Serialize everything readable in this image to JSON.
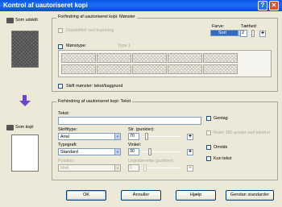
{
  "window": {
    "title": "Kontrol af uautoriseret kopi",
    "help_label": "?",
    "close_label": "✕"
  },
  "side": {
    "original_label": "Som udskilt",
    "copy_label": "Som kopi"
  },
  "pattern_section": {
    "legend": "Forfindring af uautoriseret kopi: Mønster",
    "datafield_label": "Datafeltfelt ved kopiering",
    "color_label": "Farve:",
    "color_value": "Sort",
    "density_label": "Tæthed:",
    "density_value": "2",
    "pattern_type_label": "Mønstype:",
    "type_label": "Type 1",
    "swap_label": "Skift mønster: tekst/baggrund"
  },
  "text_section": {
    "legend": "Forhindring af uautoriseret kopi: Tekst",
    "text_label": "Tekst:",
    "text_value": "",
    "font_label": "Skrifttype:",
    "font_value": "Arial",
    "size_label": "Str. (punkter):",
    "size_value": "70",
    "style_label": "Typografi:",
    "style_value": "Standard",
    "angle_label": "Vinkel:",
    "angle_value": "30",
    "position_label": "Position:",
    "position_value": "Midt",
    "outline_label": "Linjestørrelse (punkter):",
    "outline_value": "1",
    "repeat_label": "Gentag",
    "rotate_label": "Roter 180 grader ved tekstrul",
    "outline_check_label": "Omrids",
    "text_only_label": "Kun tekst"
  },
  "footer": {
    "ok": "OK",
    "cancel": "Annuller",
    "help": "Hjælp",
    "defaults": "Gendan standarder"
  },
  "colors": {
    "titlebar": "#0a58e0",
    "selected": "#316ac5",
    "arrow": "#6b44d0"
  }
}
